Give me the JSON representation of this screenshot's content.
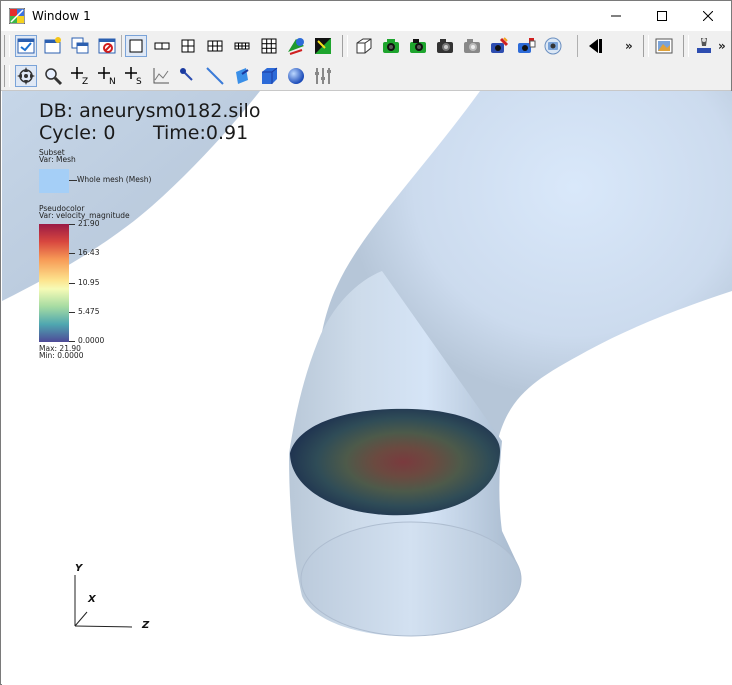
{
  "window": {
    "title": "Window 1"
  },
  "titlebar_buttons": {
    "minimize": "minimize-icon",
    "maximize": "maximize-icon",
    "close": "close-icon"
  },
  "toolbar1": {
    "icons": [
      "active-window-icon",
      "new-window-icon",
      "clone-window-icon",
      "delete-window-icon",
      "layout-1x1-icon",
      "layout-1x2-icon",
      "layout-2x2-icon",
      "layout-2x3-icon",
      "layout-2x4-icon",
      "layout-3x3-icon",
      "lock-view-icon",
      "lock-time-icon",
      "view-3d-icon",
      "camera-icon",
      "save-image-icon",
      "print-icon",
      "copy-icon",
      "play-icon",
      "undo-icon"
    ],
    "overflow": "»"
  },
  "toolbar2": {
    "icons": [
      "navigate-icon",
      "zoom-icon",
      "zone-pick-icon",
      "node-pick-icon",
      "spreadsheet-pick-icon",
      "lineout-icon",
      "point-tool-icon",
      "line-tool-icon",
      "plane-tool-icon",
      "box-tool-icon",
      "sphere-tool-icon",
      "axis-restriction-icon"
    ],
    "pick_labels": [
      "Z",
      "N",
      "S"
    ]
  },
  "annotation": {
    "db": "DB: aneurysm0182.silo",
    "cycle": "Cycle: 0",
    "time": "Time:0.91"
  },
  "subset_legend": {
    "title": "Subset",
    "var": "Var: Mesh",
    "entry": "Whole mesh (Mesh)",
    "color": "#a5cff7"
  },
  "pseudocolor_legend": {
    "title": "Pseudocolor",
    "var": "Var: velocity_magnitude",
    "ticks": [
      "21.90",
      "16.43",
      "10.95",
      "5.475",
      "0.0000"
    ],
    "max": "Max: 21.90",
    "min": "Min: 0.0000"
  },
  "axes": {
    "y": "Y",
    "x": "X",
    "z": "Z"
  }
}
